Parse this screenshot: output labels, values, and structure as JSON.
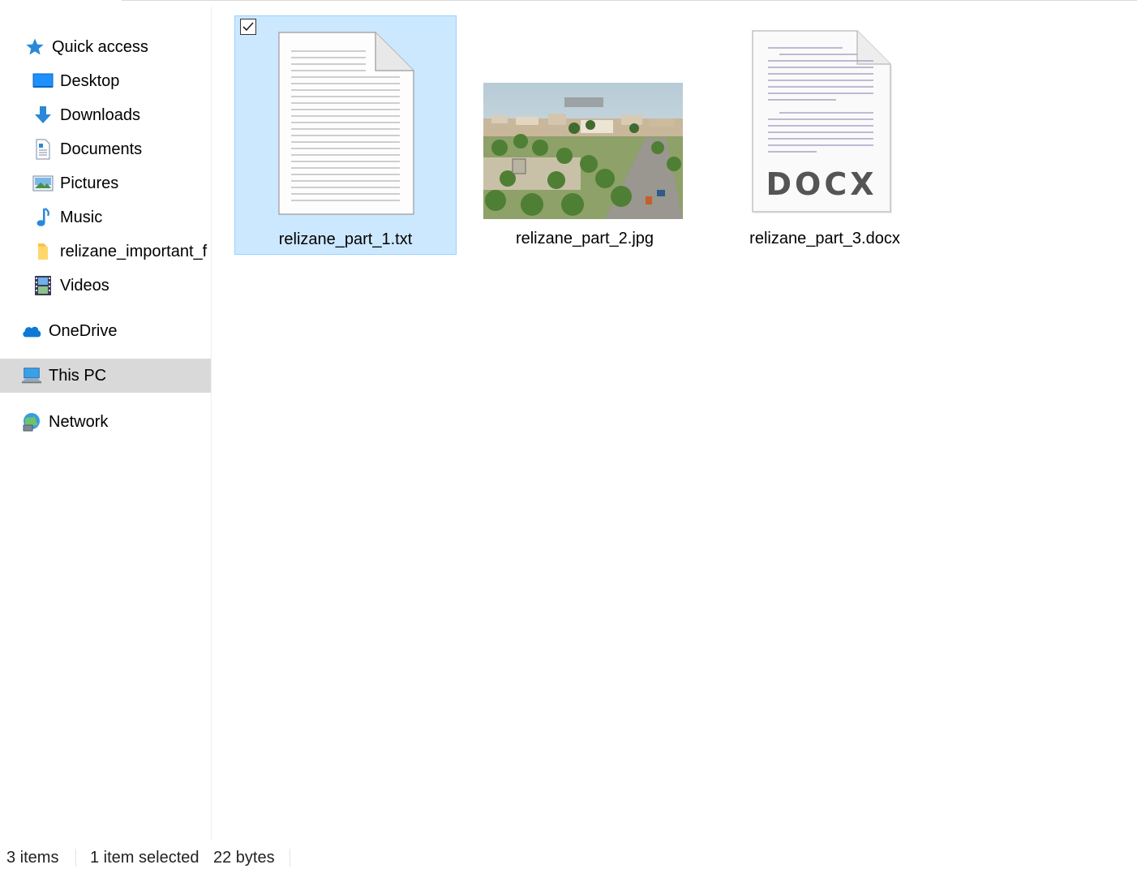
{
  "sidebar": {
    "quick_access": {
      "label": "Quick access",
      "icon": "star-icon",
      "color": "#2b88d8"
    },
    "pinned": [
      {
        "label": "Desktop",
        "icon": "desktop-icon",
        "pinned": true
      },
      {
        "label": "Downloads",
        "icon": "download-arrow-icon",
        "pinned": true
      },
      {
        "label": "Documents",
        "icon": "document-icon",
        "pinned": true
      },
      {
        "label": "Pictures",
        "icon": "pictures-icon",
        "pinned": true
      },
      {
        "label": "Music",
        "icon": "music-note-icon",
        "pinned": true
      },
      {
        "label": "relizane_important_f",
        "icon": "folder-icon",
        "pinned": false
      },
      {
        "label": "Videos",
        "icon": "video-film-icon",
        "pinned": false
      }
    ],
    "onedrive": {
      "label": "OneDrive",
      "icon": "cloud-icon"
    },
    "this_pc": {
      "label": "This PC",
      "icon": "computer-icon",
      "selected": true
    },
    "network": {
      "label": "Network",
      "icon": "network-icon"
    }
  },
  "files": [
    {
      "name": "relizane_part_1.txt",
      "type": "txt",
      "icon": "text-file-icon",
      "selected": true
    },
    {
      "name": "relizane_part_2.jpg",
      "type": "jpg",
      "icon": "image-thumbnail",
      "selected": false
    },
    {
      "name": "relizane_part_3.docx",
      "type": "docx",
      "icon": "docx-file-icon",
      "badge": "DOCX",
      "selected": false
    }
  ],
  "status": {
    "item_count": "3 items",
    "selected_count": "1 item selected",
    "selected_size": "22 bytes"
  },
  "colors": {
    "selection_bg": "#cce8ff",
    "selection_border": "#99d1ff",
    "nav_selected_bg": "#d9d9d9",
    "accent": "#2b88d8"
  }
}
